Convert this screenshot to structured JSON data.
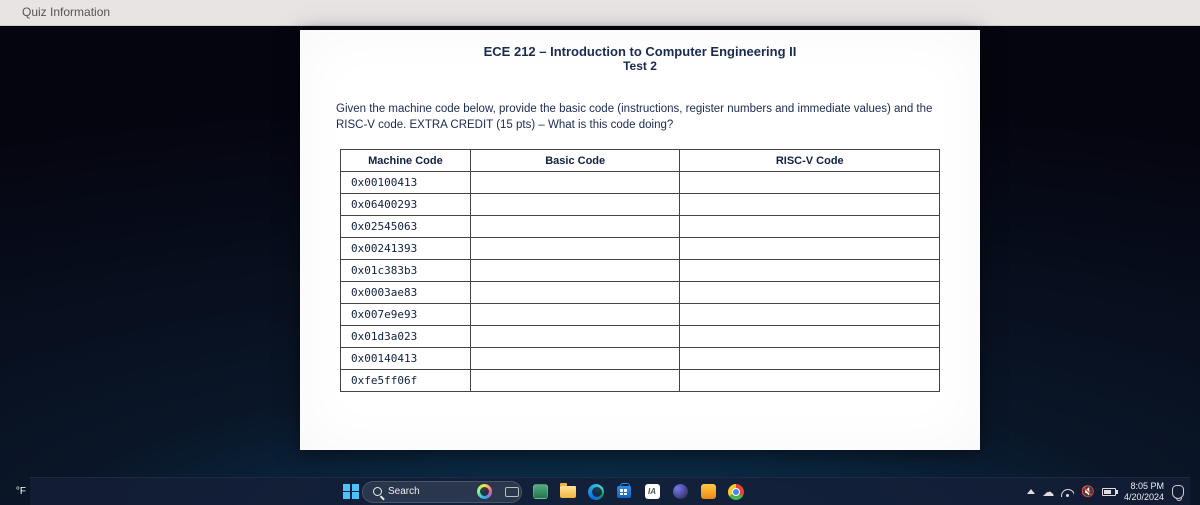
{
  "browser": {
    "tab_title": "Quiz Information"
  },
  "document": {
    "course_title": "ECE 212 – Introduction to Computer Engineering II",
    "test_label": "Test 2",
    "instructions": "Given the machine code below, provide the basic code (instructions, register numbers and immediate values) and the RISC-V code.  EXTRA CREDIT (15 pts) – What is this code doing?",
    "headers": {
      "machine": "Machine Code",
      "basic": "Basic Code",
      "riscv": "RISC-V Code"
    },
    "rows": [
      {
        "machine": "0x00100413",
        "basic": "",
        "riscv": ""
      },
      {
        "machine": "0x06400293",
        "basic": "",
        "riscv": ""
      },
      {
        "machine": "0x02545063",
        "basic": "",
        "riscv": ""
      },
      {
        "machine": "0x00241393",
        "basic": "",
        "riscv": ""
      },
      {
        "machine": "0x01c383b3",
        "basic": "",
        "riscv": ""
      },
      {
        "machine": "0x0003ae83",
        "basic": "",
        "riscv": ""
      },
      {
        "machine": "0x007e9e93",
        "basic": "",
        "riscv": ""
      },
      {
        "machine": "0x01d3a023",
        "basic": "",
        "riscv": ""
      },
      {
        "machine": "0x00140413",
        "basic": "",
        "riscv": ""
      },
      {
        "machine": "0xfe5ff06f",
        "basic": "",
        "riscv": ""
      }
    ]
  },
  "taskbar": {
    "weather_unit": "°F",
    "search_placeholder": "Search",
    "time": "8:05 PM",
    "date": "4/20/2024"
  }
}
